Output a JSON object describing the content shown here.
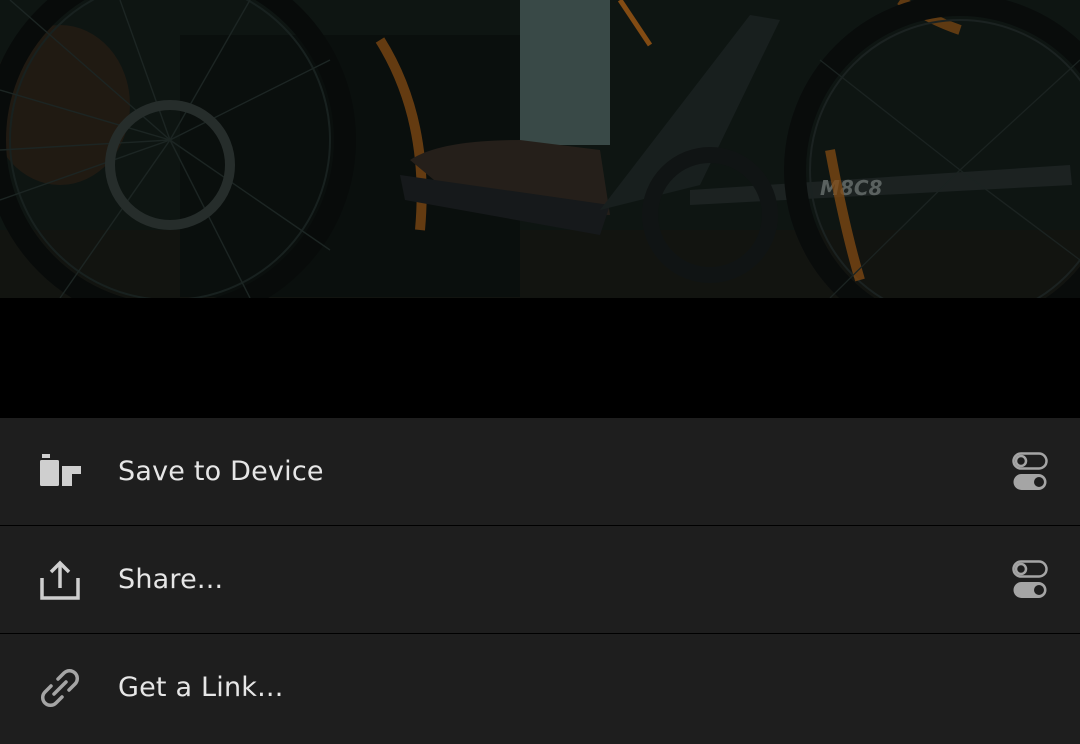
{
  "preview": {
    "description_icon": "photo-preview",
    "frame_text": "M8C8"
  },
  "export_menu": {
    "items": [
      {
        "label": "Save to Device",
        "icon": "save-device-icon",
        "has_settings": true
      },
      {
        "label": "Share...",
        "icon": "share-icon",
        "has_settings": true
      },
      {
        "label": "Get a Link...",
        "icon": "link-icon",
        "has_settings": false
      }
    ]
  },
  "colors": {
    "sheet_bg": "#1e1e1e",
    "text": "#e6e6e6",
    "icon": "#cfcfcf",
    "accent_orange": "#c8731e"
  }
}
